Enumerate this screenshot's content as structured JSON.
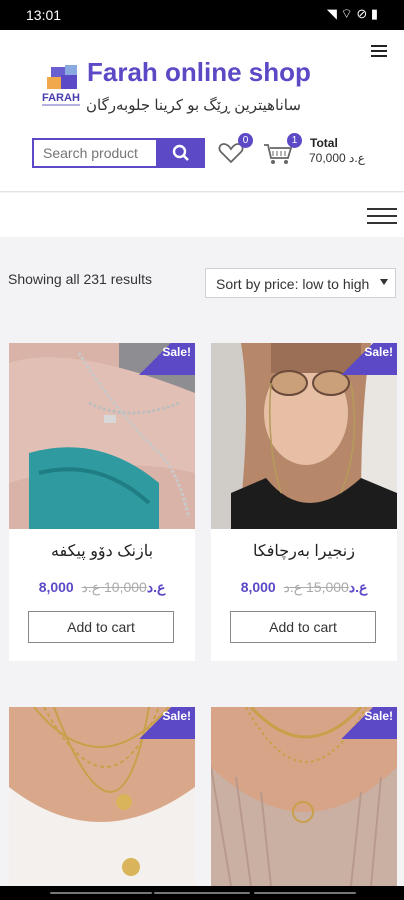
{
  "status": {
    "time": "13:01",
    "icons": "◥ ⌔ ⊘ ▮"
  },
  "brand": {
    "title": "Farah online shop",
    "subtitle": "ساناهیترین ڕێگ بو کرینا جلوبەرگان",
    "logo_text": "FARAH"
  },
  "search": {
    "placeholder": "Search product"
  },
  "wishlist": {
    "count": "0"
  },
  "cart": {
    "count": "1",
    "total_label": "Total",
    "total_value": "70,000 ع.د"
  },
  "results": {
    "showing": "Showing all 231 results",
    "sort_selected": "Sort by price: low to high"
  },
  "products": [
    {
      "name": "بازنک دۆو پیکفە",
      "price": "8,000 ع.د",
      "old_price": "10,000 ع.د",
      "sale": "Sale!",
      "button": "Add to cart"
    },
    {
      "name": "زنجیرا بەرچافکا",
      "price": "8,000 ع.د",
      "old_price": "15,000 ع.د",
      "sale": "Sale!",
      "button": "Add to cart"
    },
    {
      "sale": "Sale!"
    },
    {
      "sale": "Sale!"
    }
  ],
  "colors": {
    "accent": "#5b49c6"
  }
}
